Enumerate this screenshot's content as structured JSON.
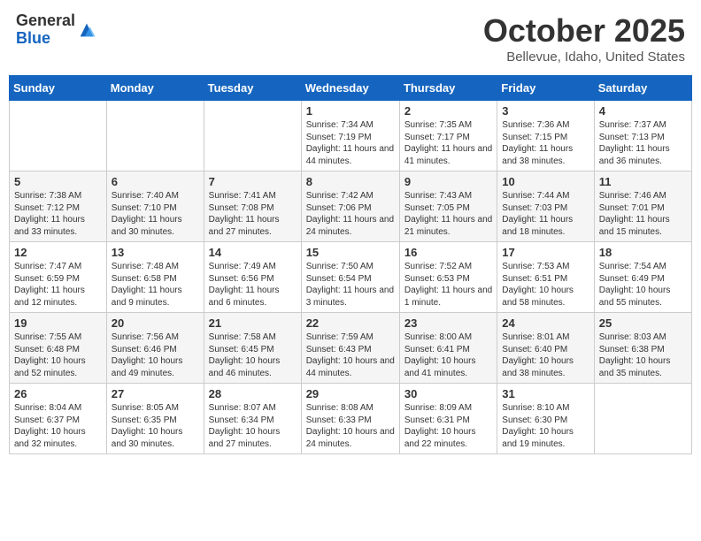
{
  "header": {
    "logo_general": "General",
    "logo_blue": "Blue",
    "month": "October 2025",
    "location": "Bellevue, Idaho, United States"
  },
  "days_of_week": [
    "Sunday",
    "Monday",
    "Tuesday",
    "Wednesday",
    "Thursday",
    "Friday",
    "Saturday"
  ],
  "weeks": [
    [
      {
        "num": "",
        "info": ""
      },
      {
        "num": "",
        "info": ""
      },
      {
        "num": "",
        "info": ""
      },
      {
        "num": "1",
        "info": "Sunrise: 7:34 AM\nSunset: 7:19 PM\nDaylight: 11 hours and 44 minutes."
      },
      {
        "num": "2",
        "info": "Sunrise: 7:35 AM\nSunset: 7:17 PM\nDaylight: 11 hours and 41 minutes."
      },
      {
        "num": "3",
        "info": "Sunrise: 7:36 AM\nSunset: 7:15 PM\nDaylight: 11 hours and 38 minutes."
      },
      {
        "num": "4",
        "info": "Sunrise: 7:37 AM\nSunset: 7:13 PM\nDaylight: 11 hours and 36 minutes."
      }
    ],
    [
      {
        "num": "5",
        "info": "Sunrise: 7:38 AM\nSunset: 7:12 PM\nDaylight: 11 hours and 33 minutes."
      },
      {
        "num": "6",
        "info": "Sunrise: 7:40 AM\nSunset: 7:10 PM\nDaylight: 11 hours and 30 minutes."
      },
      {
        "num": "7",
        "info": "Sunrise: 7:41 AM\nSunset: 7:08 PM\nDaylight: 11 hours and 27 minutes."
      },
      {
        "num": "8",
        "info": "Sunrise: 7:42 AM\nSunset: 7:06 PM\nDaylight: 11 hours and 24 minutes."
      },
      {
        "num": "9",
        "info": "Sunrise: 7:43 AM\nSunset: 7:05 PM\nDaylight: 11 hours and 21 minutes."
      },
      {
        "num": "10",
        "info": "Sunrise: 7:44 AM\nSunset: 7:03 PM\nDaylight: 11 hours and 18 minutes."
      },
      {
        "num": "11",
        "info": "Sunrise: 7:46 AM\nSunset: 7:01 PM\nDaylight: 11 hours and 15 minutes."
      }
    ],
    [
      {
        "num": "12",
        "info": "Sunrise: 7:47 AM\nSunset: 6:59 PM\nDaylight: 11 hours and 12 minutes."
      },
      {
        "num": "13",
        "info": "Sunrise: 7:48 AM\nSunset: 6:58 PM\nDaylight: 11 hours and 9 minutes."
      },
      {
        "num": "14",
        "info": "Sunrise: 7:49 AM\nSunset: 6:56 PM\nDaylight: 11 hours and 6 minutes."
      },
      {
        "num": "15",
        "info": "Sunrise: 7:50 AM\nSunset: 6:54 PM\nDaylight: 11 hours and 3 minutes."
      },
      {
        "num": "16",
        "info": "Sunrise: 7:52 AM\nSunset: 6:53 PM\nDaylight: 11 hours and 1 minute."
      },
      {
        "num": "17",
        "info": "Sunrise: 7:53 AM\nSunset: 6:51 PM\nDaylight: 10 hours and 58 minutes."
      },
      {
        "num": "18",
        "info": "Sunrise: 7:54 AM\nSunset: 6:49 PM\nDaylight: 10 hours and 55 minutes."
      }
    ],
    [
      {
        "num": "19",
        "info": "Sunrise: 7:55 AM\nSunset: 6:48 PM\nDaylight: 10 hours and 52 minutes."
      },
      {
        "num": "20",
        "info": "Sunrise: 7:56 AM\nSunset: 6:46 PM\nDaylight: 10 hours and 49 minutes."
      },
      {
        "num": "21",
        "info": "Sunrise: 7:58 AM\nSunset: 6:45 PM\nDaylight: 10 hours and 46 minutes."
      },
      {
        "num": "22",
        "info": "Sunrise: 7:59 AM\nSunset: 6:43 PM\nDaylight: 10 hours and 44 minutes."
      },
      {
        "num": "23",
        "info": "Sunrise: 8:00 AM\nSunset: 6:41 PM\nDaylight: 10 hours and 41 minutes."
      },
      {
        "num": "24",
        "info": "Sunrise: 8:01 AM\nSunset: 6:40 PM\nDaylight: 10 hours and 38 minutes."
      },
      {
        "num": "25",
        "info": "Sunrise: 8:03 AM\nSunset: 6:38 PM\nDaylight: 10 hours and 35 minutes."
      }
    ],
    [
      {
        "num": "26",
        "info": "Sunrise: 8:04 AM\nSunset: 6:37 PM\nDaylight: 10 hours and 32 minutes."
      },
      {
        "num": "27",
        "info": "Sunrise: 8:05 AM\nSunset: 6:35 PM\nDaylight: 10 hours and 30 minutes."
      },
      {
        "num": "28",
        "info": "Sunrise: 8:07 AM\nSunset: 6:34 PM\nDaylight: 10 hours and 27 minutes."
      },
      {
        "num": "29",
        "info": "Sunrise: 8:08 AM\nSunset: 6:33 PM\nDaylight: 10 hours and 24 minutes."
      },
      {
        "num": "30",
        "info": "Sunrise: 8:09 AM\nSunset: 6:31 PM\nDaylight: 10 hours and 22 minutes."
      },
      {
        "num": "31",
        "info": "Sunrise: 8:10 AM\nSunset: 6:30 PM\nDaylight: 10 hours and 19 minutes."
      },
      {
        "num": "",
        "info": ""
      }
    ]
  ]
}
